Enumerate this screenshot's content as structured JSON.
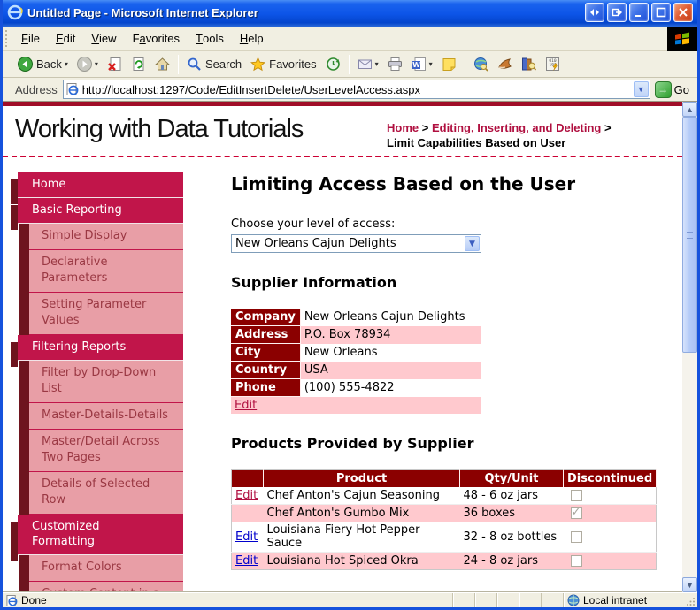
{
  "window": {
    "title": "Untitled Page - Microsoft Internet Explorer"
  },
  "menu": {
    "items": [
      {
        "label": "File",
        "accel": "F"
      },
      {
        "label": "Edit",
        "accel": "E"
      },
      {
        "label": "View",
        "accel": "V"
      },
      {
        "label": "Favorites",
        "accel": "a"
      },
      {
        "label": "Tools",
        "accel": "T"
      },
      {
        "label": "Help",
        "accel": "H"
      }
    ]
  },
  "toolbar": {
    "back_label": "Back",
    "search_label": "Search",
    "favorites_label": "Favorites"
  },
  "address": {
    "label": "Address",
    "url": "http://localhost:1297/Code/EditInsertDelete/UserLevelAccess.aspx",
    "go_label": "Go"
  },
  "masthead": {
    "title": "Working with Data Tutorials",
    "breadcrumb": {
      "home": "Home",
      "sep1": " > ",
      "section": "Editing, Inserting, and Deleting",
      "sep2": " >",
      "current": "Limit Capabilities Based on User"
    }
  },
  "sidebar": {
    "items": [
      "Home",
      "Basic Reporting",
      "Simple Display",
      "Declarative Parameters",
      "Setting Parameter Values",
      "Filtering Reports",
      "Filter by Drop-Down List",
      "Master-Details-Details",
      "Master/Detail Across Two Pages",
      "Details of Selected Row",
      "Customized Formatting",
      "Format Colors",
      "Custom Content in a"
    ]
  },
  "main": {
    "heading": "Limiting Access Based on the User",
    "access": {
      "label": "Choose your level of access:",
      "selected": "New Orleans Cajun Delights"
    },
    "supplier": {
      "heading": "Supplier Information",
      "rows": [
        {
          "label": "Company",
          "value": "New Orleans Cajun Delights"
        },
        {
          "label": "Address",
          "value": "P.O. Box 78934"
        },
        {
          "label": "City",
          "value": "New Orleans"
        },
        {
          "label": "Country",
          "value": "USA"
        },
        {
          "label": "Phone",
          "value": "(100) 555-4822"
        }
      ],
      "edit_label": "Edit"
    },
    "products": {
      "heading": "Products Provided by Supplier",
      "columns": {
        "product": "Product",
        "qty": "Qty/Unit",
        "discontinued": "Discontinued"
      },
      "rows": [
        {
          "edit": "Edit",
          "edit_style": "visited",
          "product": "Chef Anton's Cajun Seasoning",
          "qty": "48 - 6 oz jars",
          "discontinued": false
        },
        {
          "edit": "",
          "edit_style": "none",
          "product": "Chef Anton's Gumbo Mix",
          "qty": "36 boxes",
          "discontinued": true
        },
        {
          "edit": "Edit",
          "edit_style": "new",
          "product": "Louisiana Fiery Hot Pepper Sauce",
          "qty": "32 - 8 oz bottles",
          "discontinued": false
        },
        {
          "edit": "Edit",
          "edit_style": "new",
          "product": "Louisiana Hot Spiced Okra",
          "qty": "24 - 8 oz jars",
          "discontinued": false
        }
      ]
    }
  },
  "statusbar": {
    "status": "Done",
    "zone": "Local intranet"
  },
  "colors": {
    "crimson": "#C1154A",
    "maroon_accent": "#6E141E",
    "table_header": "#8B0000",
    "pink_row": "#FFC9CE",
    "pink_nav": "#E89EA6",
    "link_visited": "#B01040",
    "link_new": "#0000CC",
    "dashed_rule": "#CC0033",
    "chrome": "#F1EFE2",
    "title_blue": "#0D55E8"
  }
}
